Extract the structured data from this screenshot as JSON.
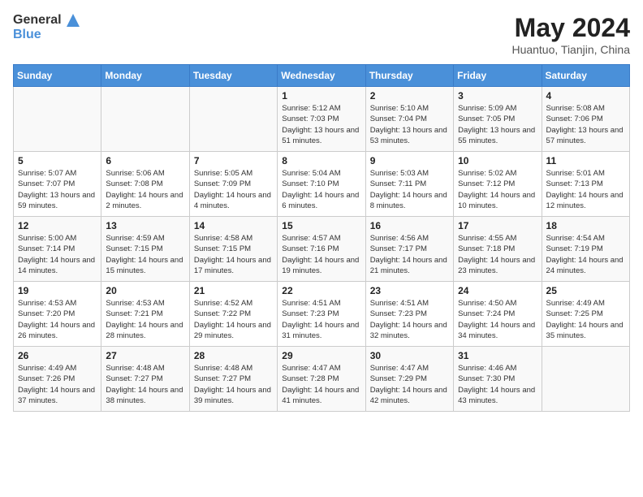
{
  "header": {
    "logo_general": "General",
    "logo_blue": "Blue",
    "month_year": "May 2024",
    "location": "Huantuo, Tianjin, China"
  },
  "days_of_week": [
    "Sunday",
    "Monday",
    "Tuesday",
    "Wednesday",
    "Thursday",
    "Friday",
    "Saturday"
  ],
  "weeks": [
    [
      {
        "day": "",
        "info": ""
      },
      {
        "day": "",
        "info": ""
      },
      {
        "day": "",
        "info": ""
      },
      {
        "day": "1",
        "info": "Sunrise: 5:12 AM\nSunset: 7:03 PM\nDaylight: 13 hours and 51 minutes."
      },
      {
        "day": "2",
        "info": "Sunrise: 5:10 AM\nSunset: 7:04 PM\nDaylight: 13 hours and 53 minutes."
      },
      {
        "day": "3",
        "info": "Sunrise: 5:09 AM\nSunset: 7:05 PM\nDaylight: 13 hours and 55 minutes."
      },
      {
        "day": "4",
        "info": "Sunrise: 5:08 AM\nSunset: 7:06 PM\nDaylight: 13 hours and 57 minutes."
      }
    ],
    [
      {
        "day": "5",
        "info": "Sunrise: 5:07 AM\nSunset: 7:07 PM\nDaylight: 13 hours and 59 minutes."
      },
      {
        "day": "6",
        "info": "Sunrise: 5:06 AM\nSunset: 7:08 PM\nDaylight: 14 hours and 2 minutes."
      },
      {
        "day": "7",
        "info": "Sunrise: 5:05 AM\nSunset: 7:09 PM\nDaylight: 14 hours and 4 minutes."
      },
      {
        "day": "8",
        "info": "Sunrise: 5:04 AM\nSunset: 7:10 PM\nDaylight: 14 hours and 6 minutes."
      },
      {
        "day": "9",
        "info": "Sunrise: 5:03 AM\nSunset: 7:11 PM\nDaylight: 14 hours and 8 minutes."
      },
      {
        "day": "10",
        "info": "Sunrise: 5:02 AM\nSunset: 7:12 PM\nDaylight: 14 hours and 10 minutes."
      },
      {
        "day": "11",
        "info": "Sunrise: 5:01 AM\nSunset: 7:13 PM\nDaylight: 14 hours and 12 minutes."
      }
    ],
    [
      {
        "day": "12",
        "info": "Sunrise: 5:00 AM\nSunset: 7:14 PM\nDaylight: 14 hours and 14 minutes."
      },
      {
        "day": "13",
        "info": "Sunrise: 4:59 AM\nSunset: 7:15 PM\nDaylight: 14 hours and 15 minutes."
      },
      {
        "day": "14",
        "info": "Sunrise: 4:58 AM\nSunset: 7:15 PM\nDaylight: 14 hours and 17 minutes."
      },
      {
        "day": "15",
        "info": "Sunrise: 4:57 AM\nSunset: 7:16 PM\nDaylight: 14 hours and 19 minutes."
      },
      {
        "day": "16",
        "info": "Sunrise: 4:56 AM\nSunset: 7:17 PM\nDaylight: 14 hours and 21 minutes."
      },
      {
        "day": "17",
        "info": "Sunrise: 4:55 AM\nSunset: 7:18 PM\nDaylight: 14 hours and 23 minutes."
      },
      {
        "day": "18",
        "info": "Sunrise: 4:54 AM\nSunset: 7:19 PM\nDaylight: 14 hours and 24 minutes."
      }
    ],
    [
      {
        "day": "19",
        "info": "Sunrise: 4:53 AM\nSunset: 7:20 PM\nDaylight: 14 hours and 26 minutes."
      },
      {
        "day": "20",
        "info": "Sunrise: 4:53 AM\nSunset: 7:21 PM\nDaylight: 14 hours and 28 minutes."
      },
      {
        "day": "21",
        "info": "Sunrise: 4:52 AM\nSunset: 7:22 PM\nDaylight: 14 hours and 29 minutes."
      },
      {
        "day": "22",
        "info": "Sunrise: 4:51 AM\nSunset: 7:23 PM\nDaylight: 14 hours and 31 minutes."
      },
      {
        "day": "23",
        "info": "Sunrise: 4:51 AM\nSunset: 7:23 PM\nDaylight: 14 hours and 32 minutes."
      },
      {
        "day": "24",
        "info": "Sunrise: 4:50 AM\nSunset: 7:24 PM\nDaylight: 14 hours and 34 minutes."
      },
      {
        "day": "25",
        "info": "Sunrise: 4:49 AM\nSunset: 7:25 PM\nDaylight: 14 hours and 35 minutes."
      }
    ],
    [
      {
        "day": "26",
        "info": "Sunrise: 4:49 AM\nSunset: 7:26 PM\nDaylight: 14 hours and 37 minutes."
      },
      {
        "day": "27",
        "info": "Sunrise: 4:48 AM\nSunset: 7:27 PM\nDaylight: 14 hours and 38 minutes."
      },
      {
        "day": "28",
        "info": "Sunrise: 4:48 AM\nSunset: 7:27 PM\nDaylight: 14 hours and 39 minutes."
      },
      {
        "day": "29",
        "info": "Sunrise: 4:47 AM\nSunset: 7:28 PM\nDaylight: 14 hours and 41 minutes."
      },
      {
        "day": "30",
        "info": "Sunrise: 4:47 AM\nSunset: 7:29 PM\nDaylight: 14 hours and 42 minutes."
      },
      {
        "day": "31",
        "info": "Sunrise: 4:46 AM\nSunset: 7:30 PM\nDaylight: 14 hours and 43 minutes."
      },
      {
        "day": "",
        "info": ""
      }
    ]
  ]
}
